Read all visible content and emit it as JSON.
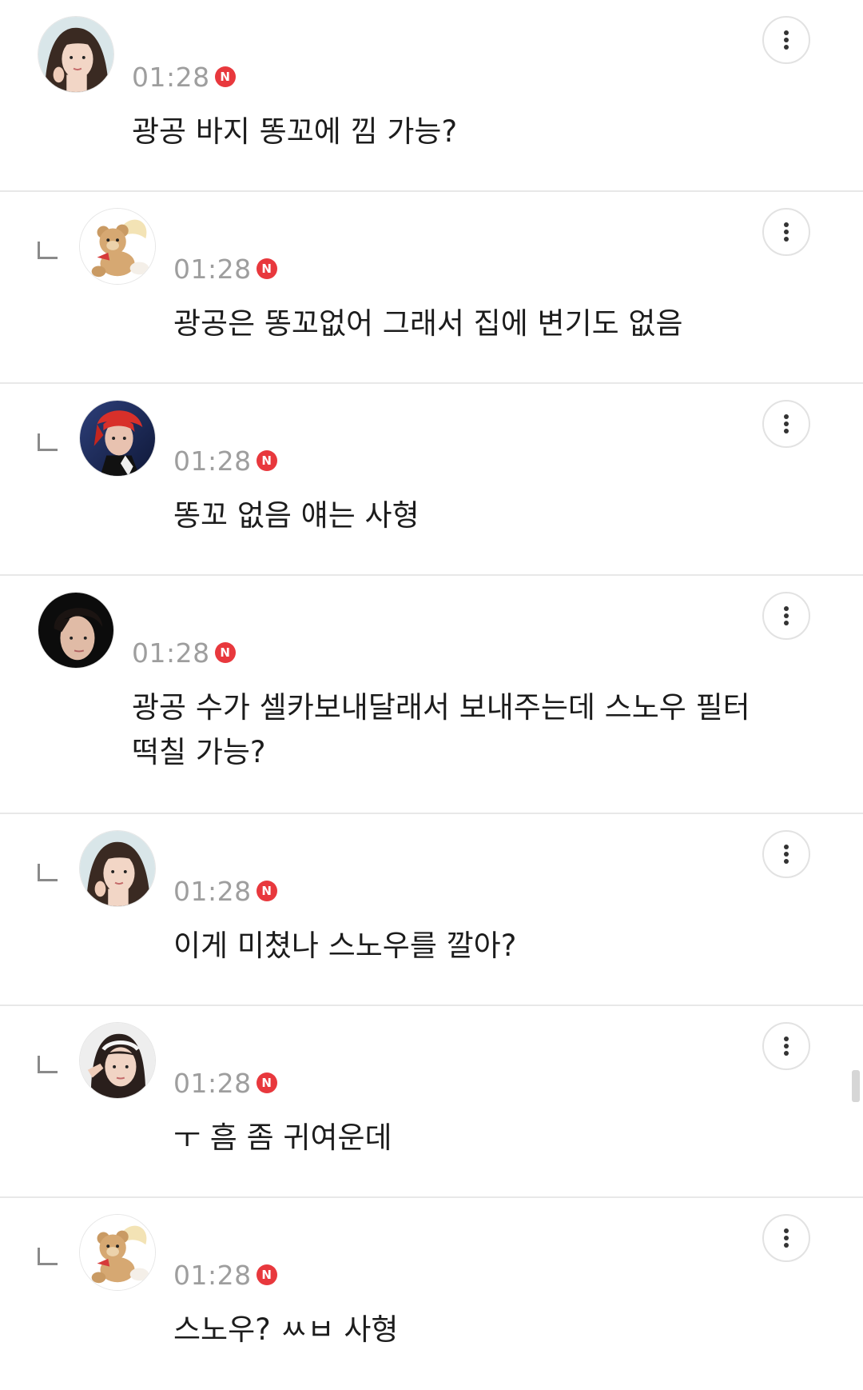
{
  "comments": [
    {
      "type": "top",
      "time": "01:28",
      "badge": "N",
      "text": "광공 바지 똥꼬에 낌 가능?",
      "avatar_icon": "girl-photo-avatar"
    },
    {
      "type": "reply",
      "time": "01:28",
      "badge": "N",
      "text": "광공은 똥꼬없어 그래서 집에 변기도 없음",
      "avatar_icon": "teddy-bear-angel-avatar"
    },
    {
      "type": "reply",
      "time": "01:28",
      "badge": "N",
      "text": "똥꼬 없음 얘는 사형",
      "avatar_icon": "red-hair-idol-avatar"
    },
    {
      "type": "top",
      "time": "01:28",
      "badge": "N",
      "text": "광공 수가 셀카보내달래서 보내주는데 스노우 필터\n떡칠 가능?",
      "avatar_icon": "dark-hair-boy-avatar"
    },
    {
      "type": "reply",
      "time": "01:28",
      "badge": "N",
      "text": "이게 미쳤나 스노우를 깔아?",
      "avatar_icon": "girl-photo-avatar"
    },
    {
      "type": "reply",
      "time": "01:28",
      "badge": "N",
      "text": "ㅜ 흠 좀 귀여운데",
      "avatar_icon": "girl-headband-avatar"
    },
    {
      "type": "reply",
      "time": "01:28",
      "badge": "N",
      "text": "스노우? ㅆㅂ 사형",
      "avatar_icon": "teddy-bear-angel-avatar"
    }
  ],
  "colors": {
    "badge": "#e8383d",
    "time": "#9e9e9e",
    "text": "#1c1c1c",
    "divider": "#e8e8e8"
  }
}
